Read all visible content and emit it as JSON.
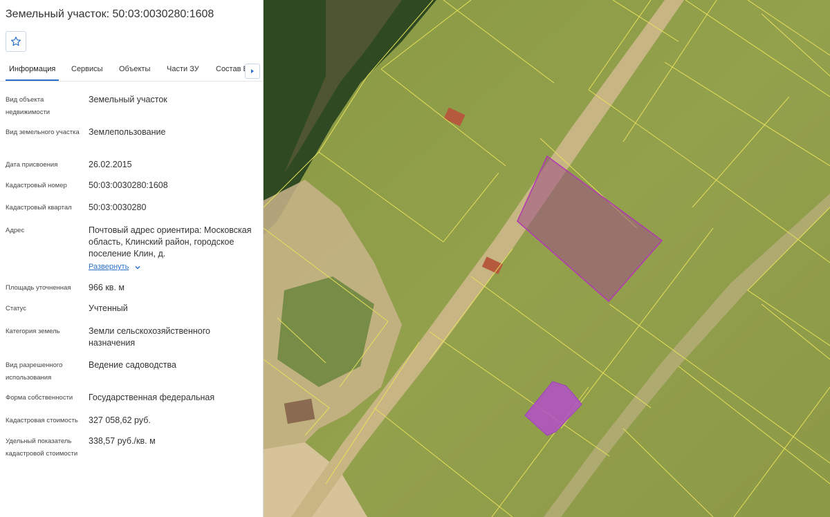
{
  "panel": {
    "title": "Земельный участок: 50:03:0030280:1608",
    "favorite_icon": "star-icon",
    "tabs": [
      {
        "label": "Информация",
        "active": true
      },
      {
        "label": "Сервисы"
      },
      {
        "label": "Объекты"
      },
      {
        "label": "Части ЗУ"
      },
      {
        "label": "Состав Е"
      }
    ],
    "tabs_next_icon": "chevron-right-icon",
    "properties": [
      {
        "label": "Вид объекта недвижимости",
        "value": "Земельный участок"
      },
      {
        "label": "Вид земельного участка",
        "value": "Землепользование"
      },
      {
        "label": "Дата присвоения",
        "value": "26.02.2015"
      },
      {
        "label": "Кадастровый номер",
        "value": "50:03:0030280:1608"
      },
      {
        "label": "Кадастровый квартал",
        "value": "50:03:0030280"
      },
      {
        "label": "Адрес",
        "value": "Почтовый адрес ориентира: Московская область, Клинский район, городское поселение Клин, д."
      },
      {
        "label": "Площадь уточненная",
        "value": "966 кв. м"
      },
      {
        "label": "Статус",
        "value": "Учтенный"
      },
      {
        "label": "Категория земель",
        "value": "Земли сельскохозяйственного назначения"
      },
      {
        "label": "Вид разрешенного использования",
        "value": "Ведение садоводства"
      },
      {
        "label": "Форма собственности",
        "value": "Государственная федеральная"
      },
      {
        "label": "Кадастровая стоимость",
        "value": "327 058,62 руб."
      },
      {
        "label": "Удельный показатель кадастровой стоимости",
        "value": "338,57 руб./кв. м"
      }
    ],
    "expand_label": "Развернуть",
    "expand_icon": "chevron-down-icon"
  },
  "map": {
    "type": "satellite",
    "colors": {
      "parcel_boundary": "#e6e05a",
      "selected_parcel_stroke": "#b23bb0",
      "selected_parcel_fill": "#9c4f86",
      "building_fill": "#b24fc8"
    }
  }
}
